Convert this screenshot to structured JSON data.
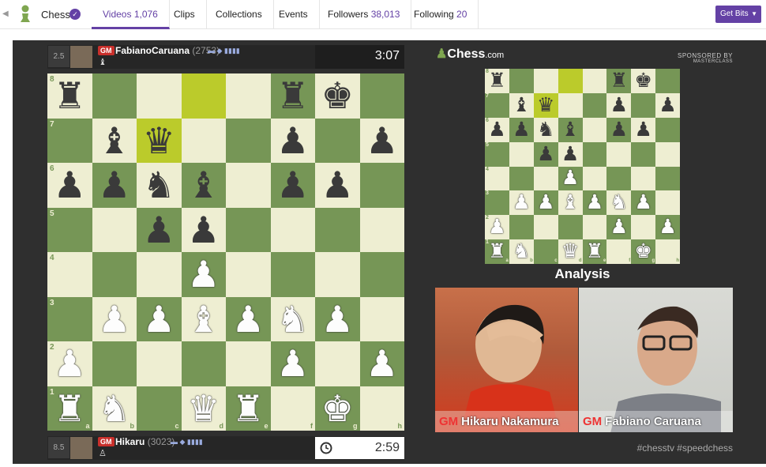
{
  "nav": {
    "channel": "Chess",
    "tabs": [
      {
        "label": "Videos",
        "count": "1,076"
      },
      {
        "label": "Clips",
        "count": ""
      },
      {
        "label": "Collections",
        "count": ""
      },
      {
        "label": "Events",
        "count": ""
      },
      {
        "label": "Followers",
        "count": "38,013"
      },
      {
        "label": "Following",
        "count": "20"
      }
    ],
    "get_bits": "Get Bits"
  },
  "top_player": {
    "score": "2.5",
    "title": "GM",
    "name": "FabianoCaruana",
    "rating": "(2753)",
    "clock": "3:07"
  },
  "bottom_player": {
    "score": "8.5",
    "title": "GM",
    "name": "Hikaru",
    "rating": "(3023)",
    "clock": "2:59"
  },
  "brand": {
    "name": "Chess",
    "suffix": ".com",
    "sponsor": "SPONSORED BY",
    "sponsor_name": "MASTERCLASS"
  },
  "analysis_label": "Analysis",
  "cams": [
    {
      "title": "GM",
      "name": "Hikaru Nakamura"
    },
    {
      "title": "GM",
      "name": "Fabiano Caruana"
    }
  ],
  "hashtags": "#chesstv #speedchess",
  "main_board": {
    "ranks": [
      "8",
      "7",
      "6",
      "5",
      "4",
      "3",
      "2",
      "1"
    ],
    "files": [
      "a",
      "b",
      "c",
      "d",
      "e",
      "f",
      "g",
      "h"
    ],
    "position": [
      [
        "bR",
        "",
        "",
        "",
        "",
        "bR",
        "bK",
        ""
      ],
      [
        "",
        "bB",
        "bQ",
        "",
        "",
        "bP",
        "",
        "bP"
      ],
      [
        "bP",
        "bP",
        "bN",
        "bB",
        "",
        "bP",
        "bP",
        ""
      ],
      [
        "",
        "",
        "bP",
        "bP",
        "",
        "",
        "",
        ""
      ],
      [
        "",
        "",
        "",
        "wP",
        "",
        "",
        "",
        ""
      ],
      [
        "",
        "wP",
        "wP",
        "wB",
        "wP",
        "wN",
        "wP",
        ""
      ],
      [
        "wP",
        "",
        "",
        "",
        "",
        "wP",
        "",
        "wP"
      ],
      [
        "wR",
        "wN",
        "",
        "wQ",
        "wR",
        "",
        "wK",
        ""
      ]
    ],
    "highlights": [
      "d8",
      "c7"
    ]
  },
  "analysis_board": {
    "position": [
      [
        "bR",
        "",
        "",
        "",
        "",
        "bR",
        "bK",
        ""
      ],
      [
        "",
        "bB",
        "bQ",
        "",
        "",
        "bP",
        "",
        "bP"
      ],
      [
        "bP",
        "bP",
        "bN",
        "bB",
        "",
        "bP",
        "bP",
        ""
      ],
      [
        "",
        "",
        "bP",
        "bP",
        "",
        "",
        "",
        ""
      ],
      [
        "",
        "",
        "",
        "wP",
        "",
        "",
        "",
        ""
      ],
      [
        "",
        "wP",
        "wP",
        "wB",
        "wP",
        "wN",
        "wP",
        ""
      ],
      [
        "wP",
        "",
        "",
        "",
        "",
        "wP",
        "",
        "wP"
      ],
      [
        "wR",
        "wN",
        "",
        "wQ",
        "wR",
        "",
        "wK",
        ""
      ]
    ],
    "highlights": [
      "d8",
      "c7"
    ]
  }
}
